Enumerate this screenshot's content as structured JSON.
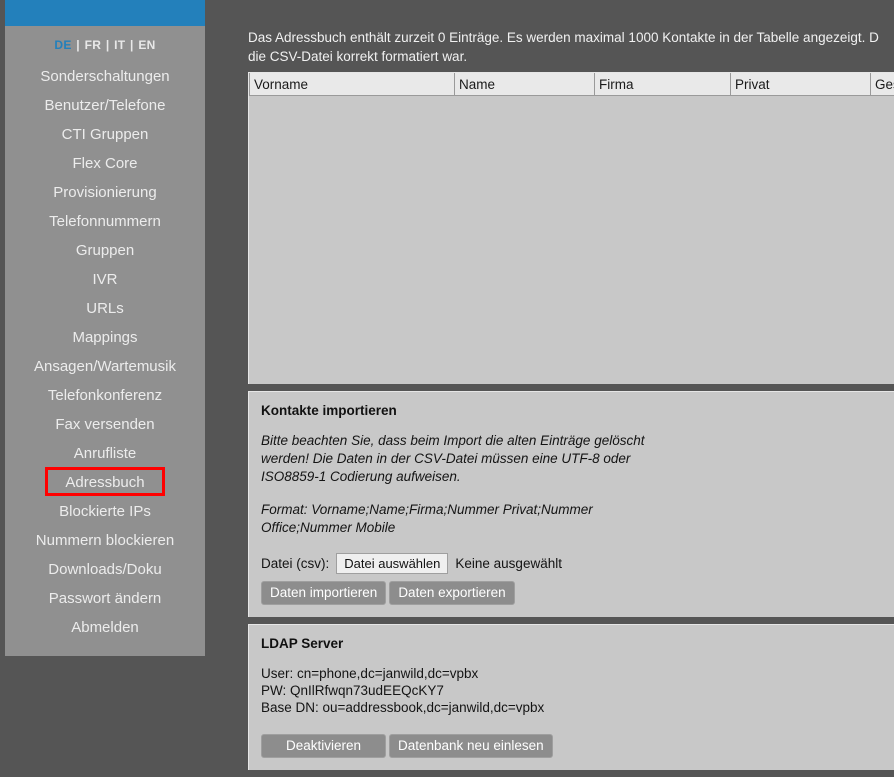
{
  "sidebar": {
    "brand_bar_color": "#2380bb",
    "languages": [
      {
        "code": "DE",
        "active": true
      },
      {
        "code": "FR",
        "active": false
      },
      {
        "code": "IT",
        "active": false
      },
      {
        "code": "EN",
        "active": false
      }
    ],
    "separator": "|",
    "items": [
      {
        "label": "Sonderschaltungen",
        "highlighted": false
      },
      {
        "label": "Benutzer/Telefone",
        "highlighted": false
      },
      {
        "label": "CTI Gruppen",
        "highlighted": false
      },
      {
        "label": "Flex Core",
        "highlighted": false
      },
      {
        "label": "Provisionierung",
        "highlighted": false
      },
      {
        "label": "Telefonnummern",
        "highlighted": false
      },
      {
        "label": "Gruppen",
        "highlighted": false
      },
      {
        "label": "IVR",
        "highlighted": false
      },
      {
        "label": "URLs",
        "highlighted": false
      },
      {
        "label": "Mappings",
        "highlighted": false
      },
      {
        "label": "Ansagen/Wartemusik",
        "highlighted": false
      },
      {
        "label": "Telefonkonferenz",
        "highlighted": false
      },
      {
        "label": "Fax versenden",
        "highlighted": false
      },
      {
        "label": "Anrufliste",
        "highlighted": false
      },
      {
        "label": "Adressbuch",
        "highlighted": true
      },
      {
        "label": "Blockierte IPs",
        "highlighted": false
      },
      {
        "label": "Nummern blockieren",
        "highlighted": false
      },
      {
        "label": "Downloads/Doku",
        "highlighted": false
      },
      {
        "label": "Passwort ändern",
        "highlighted": false
      },
      {
        "label": "Abmelden",
        "highlighted": false
      }
    ],
    "highlight_color": "#ff0000"
  },
  "main": {
    "intro": "Das Adressbuch enthält zurzeit 0 Einträge. Es werden maximal 1000 Kontakte in der Tabelle angezeigt. D",
    "intro_line2": "die CSV-Datei korrekt formatiert war.",
    "table": {
      "columns": [
        "Vorname",
        "Name",
        "Firma",
        "Privat",
        "Ges"
      ],
      "rows": []
    },
    "import": {
      "title": "Kontakte importieren",
      "note1": "Bitte beachten Sie, dass beim Import die alten Einträge gelöscht werden! Die Daten in der CSV-Datei müssen eine UTF-8 oder ISO8859-1 Codierung aufweisen.",
      "note2": "Format: Vorname;Name;Firma;Nummer Privat;Nummer Office;Nummer Mobile",
      "file_label": "Datei (csv):",
      "file_button": "Datei auswählen",
      "file_status": "Keine ausgewählt",
      "import_button": "Daten importieren",
      "export_button": "Daten exportieren"
    },
    "ldap": {
      "title": "LDAP Server",
      "user_line": "User: cn=phone,dc=janwild,dc=vpbx",
      "pw_line": "PW: QnIlRfwqn73udEEQcKY7",
      "basedn_line": "Base DN: ou=addressbook,dc=janwild,dc=vpbx",
      "deactivate_button": "Deaktivieren",
      "reload_button": "Datenbank neu einlesen"
    }
  }
}
